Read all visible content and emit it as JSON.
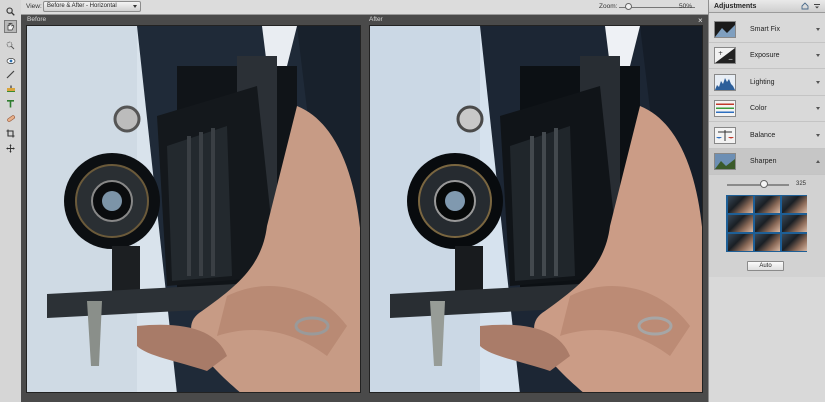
{
  "toolbar": {
    "tools": [
      "zoom-tool-icon",
      "hand-tool-icon",
      "quick-selection-tool-icon",
      "eye-tool-icon",
      "whiten-teeth-icon",
      "straighten-tool-icon",
      "type-tool-icon",
      "spot-healing-icon",
      "crop-tool-icon",
      "move-tool-icon"
    ]
  },
  "options": {
    "view_label": "View:",
    "view_value": "Before & After - Horizontal",
    "zoom_label": "Zoom:",
    "zoom_value": "50%",
    "zoom_level": 0.1
  },
  "canvas": {
    "before_label": "Before",
    "after_label": "After",
    "close_glyph": "×"
  },
  "panel": {
    "title": "Adjustments",
    "items": [
      {
        "label": "Smart Fix"
      },
      {
        "label": "Exposure"
      },
      {
        "label": "Lighting"
      },
      {
        "label": "Color"
      },
      {
        "label": "Balance"
      },
      {
        "label": "Sharpen"
      }
    ],
    "sharpen": {
      "slider_value": "325",
      "slider_fraction": 0.6,
      "auto_label": "Auto"
    }
  },
  "colors": {
    "preset_grid_bg": "#1e5f96",
    "sky": "#d8e2ec"
  }
}
